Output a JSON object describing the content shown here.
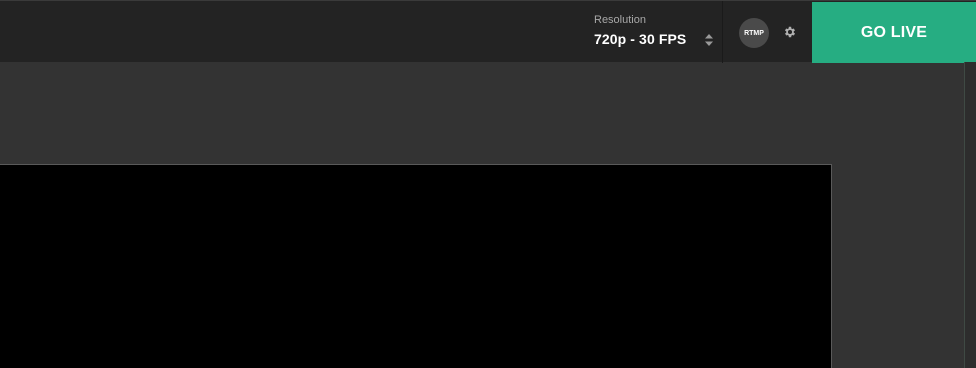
{
  "header": {
    "resolution": {
      "label": "Resolution",
      "value": "720p - 30 FPS",
      "icon": "updown-icon"
    },
    "rtmp_label": "RTMP",
    "settings_icon": "gear-icon",
    "go_live_label": "GO LIVE"
  },
  "colors": {
    "topbar": "#232323",
    "background": "#333333",
    "go_live": "#26ad82",
    "preview": "#000000"
  }
}
